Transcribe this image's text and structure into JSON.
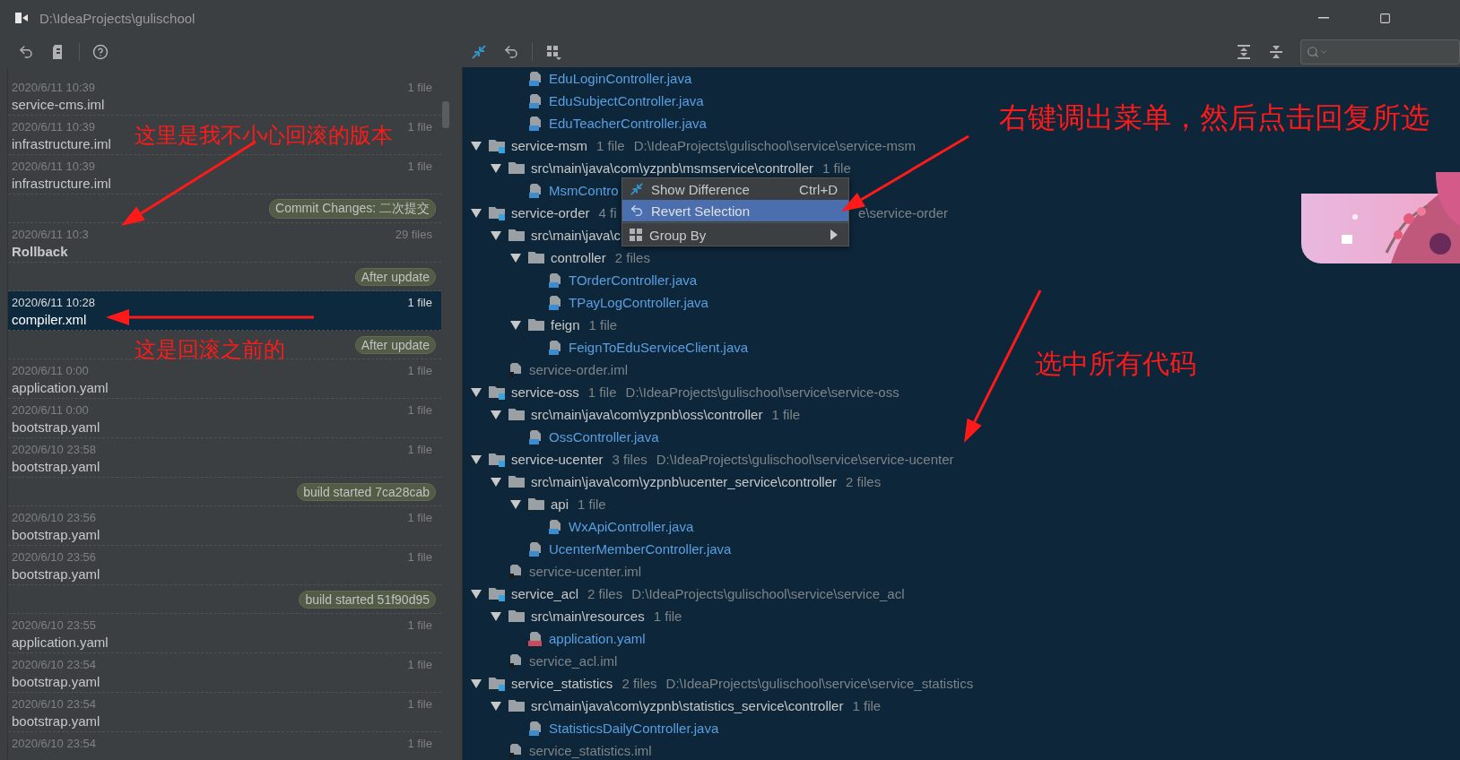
{
  "window": {
    "title": "D:\\IdeaProjects\\gulischool"
  },
  "history": [
    {
      "kind": "entry",
      "date": "2020/6/11 10:39",
      "name": "service-cms.iml",
      "count": "1 file",
      "selected": false
    },
    {
      "kind": "entry",
      "date": "2020/6/11 10:39",
      "name": "infrastructure.iml",
      "count": "1 file",
      "selected": false
    },
    {
      "kind": "entry",
      "date": "2020/6/11 10:39",
      "name": "infrastructure.iml",
      "count": "1 file",
      "selected": false
    },
    {
      "kind": "label",
      "text": "Commit Changes: 二次提交"
    },
    {
      "kind": "entry",
      "date": "2020/6/11 10:3",
      "name": "Rollback",
      "count": "29 files",
      "selected": false,
      "bold": true
    },
    {
      "kind": "label",
      "text": "After update"
    },
    {
      "kind": "entry",
      "date": "2020/6/11 10:28",
      "name": "compiler.xml",
      "count": "1 file",
      "selected": true
    },
    {
      "kind": "label",
      "text": "After update"
    },
    {
      "kind": "entry",
      "date": "2020/6/11 0:00",
      "name": "application.yaml",
      "count": "1 file",
      "selected": false
    },
    {
      "kind": "entry",
      "date": "2020/6/11 0:00",
      "name": "bootstrap.yaml",
      "count": "1 file",
      "selected": false
    },
    {
      "kind": "entry",
      "date": "2020/6/10 23:58",
      "name": "bootstrap.yaml",
      "count": "1 file",
      "selected": false
    },
    {
      "kind": "label",
      "text": "build started 7ca28cab"
    },
    {
      "kind": "entry",
      "date": "2020/6/10 23:56",
      "name": "bootstrap.yaml",
      "count": "1 file",
      "selected": false
    },
    {
      "kind": "entry",
      "date": "2020/6/10 23:56",
      "name": "bootstrap.yaml",
      "count": "1 file",
      "selected": false
    },
    {
      "kind": "label",
      "text": "build started 51f90d95"
    },
    {
      "kind": "entry",
      "date": "2020/6/10 23:55",
      "name": "application.yaml",
      "count": "1 file",
      "selected": false
    },
    {
      "kind": "entry",
      "date": "2020/6/10 23:54",
      "name": "bootstrap.yaml",
      "count": "1 file",
      "selected": false
    },
    {
      "kind": "entry",
      "date": "2020/6/10 23:54",
      "name": "bootstrap.yaml",
      "count": "1 file",
      "selected": false
    },
    {
      "kind": "entry",
      "date": "2020/6/10 23:54",
      "count": "1 file",
      "selected": false
    }
  ],
  "tree": {
    "partial_items": [
      {
        "kind": "java",
        "label": "EduLoginController.java"
      },
      {
        "kind": "java",
        "label": "EduSubjectController.java"
      },
      {
        "kind": "java",
        "label": "EduTeacherController.java"
      }
    ],
    "modules": [
      {
        "kind": "module",
        "label": "service-msm",
        "count": "1 file",
        "path": "D:\\IdeaProjects\\gulischool\\service\\service-msm",
        "expanded": true,
        "children": [
          {
            "kind": "folder",
            "label": "src\\main\\java\\com\\yzpnb\\msmservice\\controller",
            "count": "1 file",
            "expanded": true,
            "children": [
              {
                "kind": "java",
                "label": "MsmContro"
              }
            ]
          }
        ]
      },
      {
        "kind": "module",
        "label": "service-order",
        "count": "4 fi",
        "tail": "e\\service-order",
        "expanded": true,
        "children": [
          {
            "kind": "folder",
            "label": "src\\main\\java\\c",
            "expanded": true,
            "children": [
              {
                "kind": "folder",
                "label": "controller",
                "count": "2 files",
                "expanded": true,
                "children": [
                  {
                    "kind": "java",
                    "label": "TOrderController.java"
                  },
                  {
                    "kind": "java",
                    "label": "TPayLogController.java"
                  }
                ]
              },
              {
                "kind": "folder",
                "label": "feign",
                "count": "1 file",
                "expanded": true,
                "children": [
                  {
                    "kind": "java",
                    "label": "FeignToEduServiceClient.java"
                  }
                ]
              }
            ]
          },
          {
            "kind": "iml",
            "label": "service-order.iml"
          }
        ]
      },
      {
        "kind": "module",
        "label": "service-oss",
        "count": "1 file",
        "path": "D:\\IdeaProjects\\gulischool\\service\\service-oss",
        "expanded": true,
        "children": [
          {
            "kind": "folder",
            "label": "src\\main\\java\\com\\yzpnb\\oss\\controller",
            "count": "1 file",
            "expanded": true,
            "children": [
              {
                "kind": "java",
                "label": "OssController.java"
              }
            ]
          }
        ]
      },
      {
        "kind": "module",
        "label": "service-ucenter",
        "count": "3 files",
        "path": "D:\\IdeaProjects\\gulischool\\service\\service-ucenter",
        "expanded": true,
        "children": [
          {
            "kind": "folder",
            "label": "src\\main\\java\\com\\yzpnb\\ucenter_service\\controller",
            "count": "2 files",
            "expanded": true,
            "children": [
              {
                "kind": "folder",
                "label": "api",
                "count": "1 file",
                "expanded": true,
                "children": [
                  {
                    "kind": "java",
                    "label": "WxApiController.java"
                  }
                ]
              },
              {
                "kind": "java",
                "label": "UcenterMemberController.java"
              }
            ]
          },
          {
            "kind": "iml",
            "label": "service-ucenter.iml"
          }
        ]
      },
      {
        "kind": "module",
        "label": "service_acl",
        "count": "2 files",
        "path": "D:\\IdeaProjects\\gulischool\\service\\service_acl",
        "expanded": true,
        "children": [
          {
            "kind": "folder",
            "label": "src\\main\\resources",
            "count": "1 file",
            "expanded": true,
            "children": [
              {
                "kind": "yaml",
                "label": "application.yaml"
              }
            ]
          },
          {
            "kind": "iml",
            "label": "service_acl.iml"
          }
        ]
      },
      {
        "kind": "module",
        "label": "service_statistics",
        "count": "2 files",
        "path": "D:\\IdeaProjects\\gulischool\\service\\service_statistics",
        "expanded": true,
        "children": [
          {
            "kind": "folder",
            "label": "src\\main\\java\\com\\yzpnb\\statistics_service\\controller",
            "count": "1 file",
            "expanded": true,
            "children": [
              {
                "kind": "java",
                "label": "StatisticsDailyController.java"
              }
            ]
          },
          {
            "kind": "iml",
            "label": "service_statistics.iml"
          }
        ]
      }
    ]
  },
  "context_menu": [
    {
      "kind": "item",
      "label": "Show Difference",
      "shortcut": "Ctrl+D",
      "selected": false
    },
    {
      "kind": "item",
      "label": "Revert Selection",
      "selected": true
    },
    {
      "kind": "submenu",
      "label": "Group By",
      "selected": false
    }
  ],
  "annotations": [
    {
      "text": "这里是我不小心回滚的版本"
    },
    {
      "text": "这是回滚之前的"
    },
    {
      "text": "右键调出菜单，然后点击回复所选"
    },
    {
      "text": "选中所有代码"
    }
  ]
}
